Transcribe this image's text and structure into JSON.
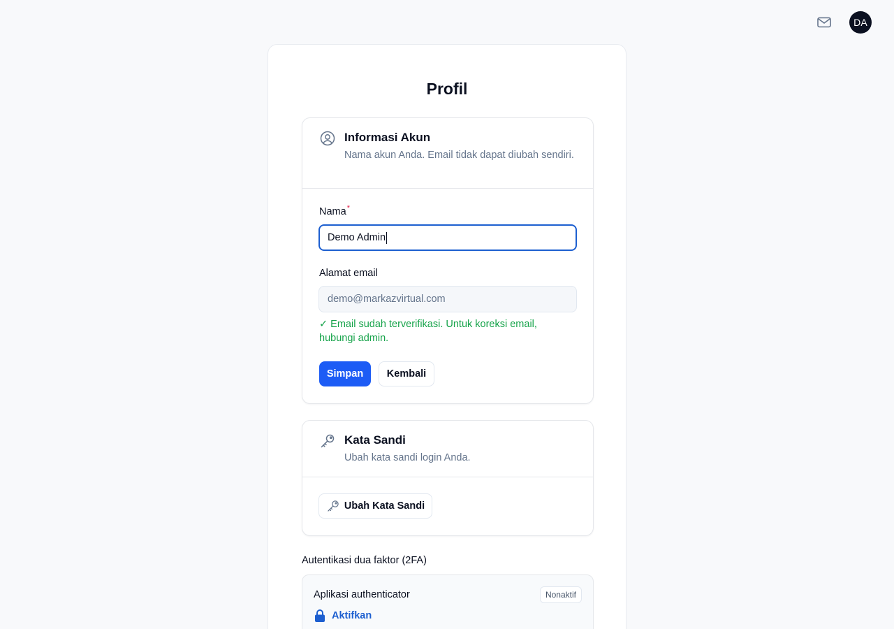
{
  "topbar": {
    "mail_icon": "mail-icon",
    "avatar_initials": "DA"
  },
  "page": {
    "title": "Profil"
  },
  "account": {
    "icon": "user-circle-icon",
    "title": "Informasi Akun",
    "description": "Nama akun Anda. Email tidak dapat diubah sendiri.",
    "name_label": "Nama",
    "required_mark": "*",
    "name_value": "Demo Admin",
    "email_label": "Alamat email",
    "email_value": "demo@markazvirtual.com",
    "verified_text": "✓ Email sudah terverifikasi. Untuk koreksi email, hubungi admin.",
    "save_label": "Simpan",
    "back_label": "Kembali"
  },
  "password": {
    "icon": "key-icon",
    "title": "Kata Sandi",
    "description": "Ubah kata sandi login Anda.",
    "change_label": "Ubah Kata Sandi"
  },
  "twofa": {
    "title": "Autentikasi dua faktor (2FA)",
    "app_label": "Aplikasi authenticator",
    "status_badge": "Nonaktif",
    "activate_label": "Aktifkan",
    "activate_icon": "lock-icon",
    "accent_color": "#1d5fd0"
  }
}
